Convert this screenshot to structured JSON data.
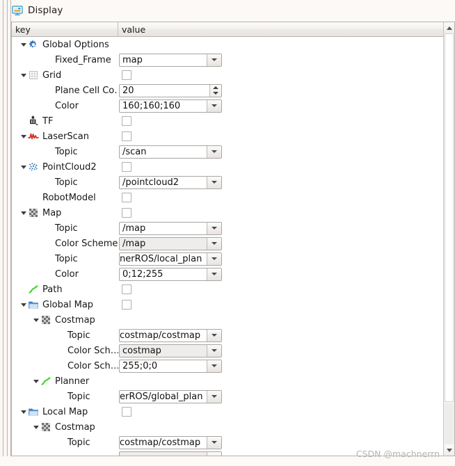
{
  "panel": {
    "title": "Display",
    "icon": "monitor-icon"
  },
  "table": {
    "columns": [
      "key",
      "value"
    ]
  },
  "watermark": "CSDN @machnerrn",
  "rows": [
    {
      "label": "Global Options",
      "indent": 0,
      "twisty": "open",
      "icon": "gear-icon",
      "widget": "none"
    },
    {
      "label": "Fixed_Frame",
      "indent": 1,
      "twisty": "none",
      "icon": "none",
      "widget": "combo",
      "value": "map"
    },
    {
      "label": "Grid",
      "indent": 0,
      "twisty": "open",
      "icon": "grid-icon",
      "widget": "checkbox",
      "value": ""
    },
    {
      "label": "Plane Cell Co…",
      "indent": 1,
      "twisty": "none",
      "icon": "none",
      "widget": "spin",
      "value": "20"
    },
    {
      "label": "Color",
      "indent": 1,
      "twisty": "none",
      "icon": "none",
      "widget": "combo",
      "value": "160;160;160"
    },
    {
      "label": "TF",
      "indent": 0,
      "twisty": "none",
      "icon": "tf-icon",
      "widget": "checkbox",
      "value": ""
    },
    {
      "label": "LaserScan",
      "indent": 0,
      "twisty": "open",
      "icon": "laserscan-icon",
      "widget": "checkbox",
      "value": ""
    },
    {
      "label": "Topic",
      "indent": 1,
      "twisty": "none",
      "icon": "none",
      "widget": "combo",
      "value": "/scan"
    },
    {
      "label": "PointCloud2",
      "indent": 0,
      "twisty": "open",
      "icon": "pointcloud-icon",
      "widget": "checkbox",
      "value": ""
    },
    {
      "label": "Topic",
      "indent": 1,
      "twisty": "none",
      "icon": "none",
      "widget": "combo",
      "value": "/pointcloud2"
    },
    {
      "label": "RobotModel",
      "indent": 0,
      "twisty": "none",
      "icon": "none",
      "widget": "checkbox",
      "value": ""
    },
    {
      "label": "Map",
      "indent": 0,
      "twisty": "open",
      "icon": "map-icon",
      "widget": "checkbox",
      "value": ""
    },
    {
      "label": "Topic",
      "indent": 1,
      "twisty": "none",
      "icon": "none",
      "widget": "combo",
      "value": "/map"
    },
    {
      "label": "Color Scheme",
      "indent": 1,
      "twisty": "none",
      "icon": "none",
      "widget": "combo-grey",
      "value": "/map"
    },
    {
      "label": "Topic",
      "indent": 1,
      "twisty": "none",
      "icon": "none",
      "widget": "combo-clip",
      "value": "nerROS/local_plan"
    },
    {
      "label": "Color",
      "indent": 1,
      "twisty": "none",
      "icon": "none",
      "widget": "combo",
      "value": "0;12;255"
    },
    {
      "label": "Path",
      "indent": 0,
      "twisty": "none",
      "icon": "path-icon",
      "widget": "checkbox",
      "value": ""
    },
    {
      "label": "Global Map",
      "indent": 0,
      "twisty": "open",
      "icon": "folder-icon",
      "widget": "checkbox",
      "value": ""
    },
    {
      "label": "Costmap",
      "indent": 1,
      "twisty": "open",
      "icon": "map-icon",
      "widget": "none"
    },
    {
      "label": "Topic",
      "indent": 2,
      "twisty": "none",
      "icon": "none",
      "widget": "combo-clip",
      "value": "costmap/costmap"
    },
    {
      "label": "Color Sch…",
      "indent": 2,
      "twisty": "none",
      "icon": "none",
      "widget": "combo-grey",
      "value": "costmap"
    },
    {
      "label": "Color Sch…",
      "indent": 2,
      "twisty": "none",
      "icon": "none",
      "widget": "combo",
      "value": "255;0;0"
    },
    {
      "label": "Planner",
      "indent": 1,
      "twisty": "open",
      "icon": "path-icon",
      "widget": "none"
    },
    {
      "label": "Topic",
      "indent": 2,
      "twisty": "none",
      "icon": "none",
      "widget": "combo-clip",
      "value": "erROS/global_plan"
    },
    {
      "label": "Local Map",
      "indent": 0,
      "twisty": "open",
      "icon": "folder-icon",
      "widget": "checkbox",
      "value": ""
    },
    {
      "label": "Costmap",
      "indent": 1,
      "twisty": "open",
      "icon": "map-icon",
      "widget": "none"
    },
    {
      "label": "Topic",
      "indent": 2,
      "twisty": "none",
      "icon": "none",
      "widget": "combo-clip",
      "value": "costmap/costmap"
    },
    {
      "label": "",
      "indent": 2,
      "twisty": "none",
      "icon": "none",
      "widget": "combo-grey",
      "value": ""
    }
  ],
  "colors": {
    "panel_background": "#fdf9f6",
    "tree_background": "#ffffff",
    "header_gradient_top": "#fcfcfc",
    "header_gradient_bottom": "#e7e4e1",
    "border": "#b6b2ae",
    "text": "#161616",
    "accent_blue": "#3b7bbf",
    "laser_red": "#d42b1f",
    "path_green": "#3fd62a",
    "watermark_grey": "#b8b4b0"
  }
}
